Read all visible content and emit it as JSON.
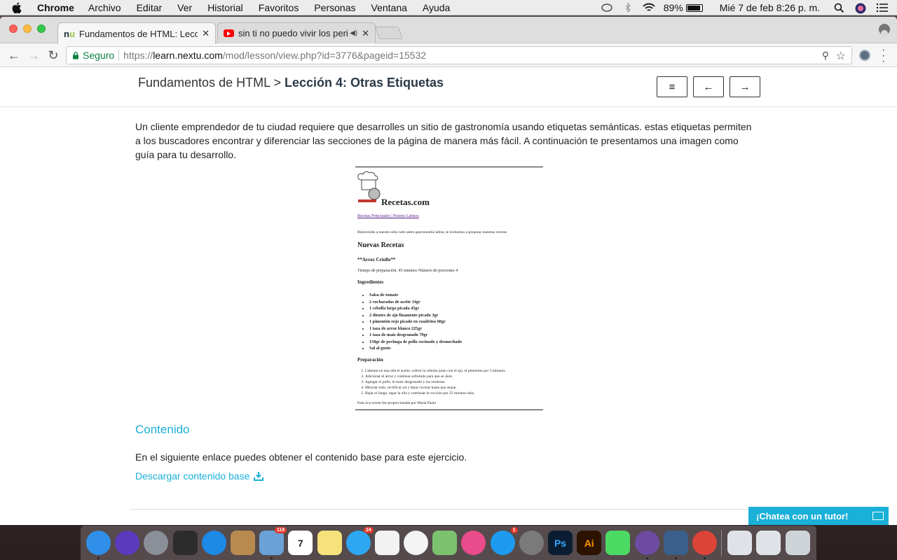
{
  "menubar": {
    "app": "Chrome",
    "items": [
      "Archivo",
      "Editar",
      "Ver",
      "Historial",
      "Favoritos",
      "Personas",
      "Ventana",
      "Ayuda"
    ],
    "battery": "89%",
    "datetime": "Mié 7 de feb  8:26 p. m."
  },
  "tabs": [
    {
      "title": "Fundamentos de HTML: Lecció",
      "favicon": "nextu-icon",
      "active": true
    },
    {
      "title": "sin ti no puedo vivir los peri",
      "favicon": "youtube-icon",
      "active": false
    }
  ],
  "toolbar": {
    "secure_label": "Seguro",
    "url_scheme": "https://",
    "url_domain": "learn.nextu.com",
    "url_path": "/mod/lesson/view.php?id=3776&pageid=15532"
  },
  "lesson": {
    "breadcrumb_parent": "Fundamentos de HTML",
    "breadcrumb_sep": ">",
    "breadcrumb_current": "Lección 4: Otras Etiquetas",
    "menu_btn": "≡",
    "prev_btn": "←",
    "next_btn": "→",
    "intro": "Un cliente emprendedor de tu ciudad requiere que desarrolles un sitio de gastronomía usando etiquetas semánticas. estas etiquetas permiten a los buscadores encontrar y diferenciar las secciones de la página de manera más fácil. A continuación te presentamos una imagen como guía para tu desarrollo.",
    "section_title": "Contenido",
    "enlace_text": "En el siguiente enlace puedes obtener el contenido base para este ejercicio.",
    "download_label": "Descargar contenido base",
    "chat_label": "¡Chatea con un tutor!"
  },
  "guide": {
    "site_name": "Recetas.com",
    "links": "Recetas Principales | Postres Latinos",
    "welcome": "Bienvenido a nuestro sitio web sobre gastronomía latina, te invitamos a preparar nuestras recetas",
    "heading": "Nuevas Recetas",
    "recipe": "**Arroz Criollo**",
    "meta": "Tiempo de preparación: 45 minutos Número de porciones 4",
    "ingredients_title": "Ingredientes",
    "ingredients": [
      "Salsa de tomate",
      "2 cucharadas de aceite 14gr",
      "1 cebolla larga picada 45gr",
      "2 dientes de ajo finamente picado 3gr",
      "1 pimentón rojo picado en cuadritos 60gr",
      "1 taza de arroz blanco 225gr",
      "1 taza de maíz desgranado 79gr",
      "150gr de pechuga de pollo cocinado y desmechado",
      "Sal al gusto"
    ],
    "prep_title": "Preparación",
    "steps": [
      "Calentar en una olla el aceite, sofreír la cebolla junto con el ajo, el pimentón por 3 minutos.",
      "Adicionar el arroz y continua sofreindo para que se dore.",
      "Agregar el pollo, el maíz desgranado y las verduras.",
      "Mezclar todo, rectificar sal y dejar cocinar hasta que seque.",
      "Bajar el fuego, tapar la olla y continuar la cocción por 25 minutos más."
    ],
    "credit": "Esta rica receta fue proporcionada por María Paula"
  },
  "dock": {
    "items": [
      {
        "name": "finder",
        "color": "#2f8fe8",
        "label": "",
        "badge": "",
        "running": true
      },
      {
        "name": "siri",
        "color": "#5b3bbd",
        "label": "",
        "badge": "",
        "running": false
      },
      {
        "name": "launchpad",
        "color": "#8a8f98",
        "label": "",
        "badge": "",
        "running": false
      },
      {
        "name": "photo-app",
        "color": "#2c2c2c",
        "label": "",
        "badge": "",
        "running": false
      },
      {
        "name": "safari",
        "color": "#1e88e5",
        "label": "",
        "badge": "",
        "running": false
      },
      {
        "name": "contacts",
        "color": "#b88a4e",
        "label": "",
        "badge": "",
        "running": false
      },
      {
        "name": "mail",
        "color": "#6aa2d8",
        "label": "",
        "badge": "119",
        "running": true
      },
      {
        "name": "calendar",
        "color": "#ffffff",
        "label": "7",
        "badge": "",
        "running": false
      },
      {
        "name": "notes",
        "color": "#f6e27a",
        "label": "",
        "badge": "",
        "running": false
      },
      {
        "name": "messages",
        "color": "#2ea7f2",
        "label": "",
        "badge": "24",
        "running": false
      },
      {
        "name": "reminders",
        "color": "#f2f2f2",
        "label": "",
        "badge": "",
        "running": false
      },
      {
        "name": "photos",
        "color": "#f4f4f4",
        "label": "",
        "badge": "",
        "running": false
      },
      {
        "name": "maps",
        "color": "#7bc26f",
        "label": "",
        "badge": "",
        "running": false
      },
      {
        "name": "itunes",
        "color": "#e94b8b",
        "label": "",
        "badge": "",
        "running": false
      },
      {
        "name": "app-store",
        "color": "#1d9bf0",
        "label": "",
        "badge": "1",
        "running": false
      },
      {
        "name": "system-preferences",
        "color": "#7a7a7a",
        "label": "",
        "badge": "",
        "running": false
      },
      {
        "name": "photoshop",
        "color": "#0b1d33",
        "label": "Ps",
        "badge": "",
        "running": false
      },
      {
        "name": "illustrator",
        "color": "#2c1300",
        "label": "Ai",
        "badge": "",
        "running": false
      },
      {
        "name": "facetime",
        "color": "#4cd964",
        "label": "",
        "badge": "",
        "running": false
      },
      {
        "name": "github",
        "color": "#6e4ba0",
        "label": "",
        "badge": "",
        "running": true
      },
      {
        "name": "brackets",
        "color": "#3a5f8a",
        "label": "",
        "badge": "",
        "running": true
      },
      {
        "name": "chrome",
        "color": "#db4437",
        "label": "",
        "badge": "",
        "running": true
      },
      {
        "name": "separator",
        "color": "transparent",
        "label": "",
        "badge": "",
        "running": false
      },
      {
        "name": "mail-window",
        "color": "#dfe3e8",
        "label": "",
        "badge": "",
        "running": false
      },
      {
        "name": "preview",
        "color": "#dfe3e8",
        "label": "",
        "badge": "",
        "running": false
      },
      {
        "name": "trash",
        "color": "#cfd4d9",
        "label": "",
        "badge": "",
        "running": false
      }
    ]
  },
  "colors": {
    "accent": "#1ab0d8",
    "secure": "#0b8043"
  }
}
